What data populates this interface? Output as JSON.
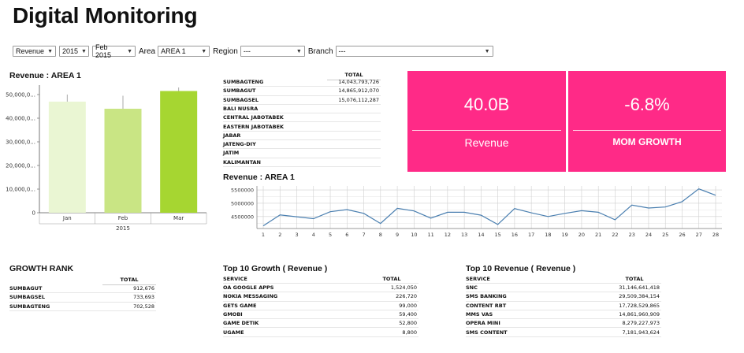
{
  "page": {
    "title": "Digital Monitoring"
  },
  "filters": {
    "metric": "Revenue",
    "year": "2015",
    "period": "Feb 2015",
    "area_label": "Area",
    "area": "AREA 1",
    "region_label": "Region",
    "region": "---",
    "branch_label": "Branch",
    "branch": "---"
  },
  "bar_panel": {
    "title": "Revenue : AREA 1",
    "chart_data": {
      "type": "bar",
      "categories": [
        "Jan",
        "Feb",
        "Mar"
      ],
      "values": [
        47000000,
        44000000,
        51500000
      ],
      "error_high": [
        50000000,
        49500000,
        53000000
      ],
      "xlabel": "2015",
      "ylim": [
        0,
        54000000
      ],
      "yticks": [
        0,
        10000000,
        20000000,
        30000000,
        40000000,
        50000000
      ],
      "ytick_labels": [
        "0",
        "10,000,0...",
        "20,000,0...",
        "30,000,0...",
        "40,000,0...",
        "50,000,0..."
      ],
      "colors": [
        "#eaf6d3",
        "#c9e584",
        "#a6d631"
      ]
    }
  },
  "region_table": {
    "header": "TOTAL",
    "rows": [
      {
        "name": "SUMBAGTENG",
        "total": "14,043,793,726"
      },
      {
        "name": "SUMBAGUT",
        "total": "14,865,912,070"
      },
      {
        "name": "SUMBAGSEL",
        "total": "15,076,112,287"
      },
      {
        "name": "BALI NUSRA",
        "total": ""
      },
      {
        "name": "CENTRAL JABOTABEK",
        "total": ""
      },
      {
        "name": "EASTERN JABOTABEK",
        "total": ""
      },
      {
        "name": "JABAR",
        "total": ""
      },
      {
        "name": "JATENG-DIY",
        "total": ""
      },
      {
        "name": "JATIM",
        "total": ""
      },
      {
        "name": "KALIMANTAN",
        "total": ""
      }
    ]
  },
  "kpis": {
    "revenue": {
      "value": "40.0B",
      "label": "Revenue"
    },
    "growth": {
      "value": "-6.8%",
      "label": "MOM GROWTH"
    }
  },
  "line_panel": {
    "title": "Revenue : AREA 1",
    "chart_data": {
      "type": "line",
      "x": [
        1,
        2,
        3,
        4,
        5,
        6,
        7,
        8,
        9,
        10,
        11,
        12,
        13,
        14,
        15,
        16,
        17,
        18,
        19,
        20,
        21,
        22,
        23,
        24,
        25,
        26,
        27,
        28
      ],
      "values": [
        4150000,
        4560000,
        4490000,
        4420000,
        4680000,
        4760000,
        4620000,
        4240000,
        4810000,
        4710000,
        4440000,
        4660000,
        4660000,
        4550000,
        4200000,
        4800000,
        4640000,
        4500000,
        4620000,
        4720000,
        4660000,
        4380000,
        4930000,
        4820000,
        4860000,
        5060000,
        5540000,
        5300000
      ],
      "ylim": [
        4050000,
        5650000
      ],
      "yticks": [
        4500000,
        5000000,
        5500000
      ],
      "ytick_labels": [
        "4500000",
        "5000000",
        "5500000"
      ],
      "color": "#4a7fb0"
    }
  },
  "growth_rank": {
    "title": "GROWTH RANK",
    "header": "TOTAL",
    "rows": [
      {
        "name": "SUMBAGUT",
        "total": "912,676"
      },
      {
        "name": "SUMBAGSEL",
        "total": "733,693"
      },
      {
        "name": "SUMBAGTENG",
        "total": "702,528"
      }
    ]
  },
  "top_growth": {
    "title": "Top 10 Growth ( Revenue )",
    "col_service": "SERVICE",
    "col_total": "TOTAL",
    "rows": [
      {
        "name": "OA GOOGLE APPS",
        "total": "1,524,050"
      },
      {
        "name": "NOKIA MESSAGING",
        "total": "226,720"
      },
      {
        "name": "GETS GAME",
        "total": "99,000"
      },
      {
        "name": "GMOBI",
        "total": "59,400"
      },
      {
        "name": "GAME DETIK",
        "total": "52,800"
      },
      {
        "name": "UGAME",
        "total": "8,800"
      }
    ]
  },
  "top_revenue": {
    "title": "Top 10 Revenue ( Revenue )",
    "col_service": "SERVICE",
    "col_total": "TOTAL",
    "rows": [
      {
        "name": "SNC",
        "total": "31,146,641,418"
      },
      {
        "name": "SMS BANKING",
        "total": "29,509,384,154"
      },
      {
        "name": "CONTENT RBT",
        "total": "17,728,529,865"
      },
      {
        "name": "MMS VAS",
        "total": "14,861,960,909"
      },
      {
        "name": "OPERA MINI",
        "total": "8,279,227,973"
      },
      {
        "name": "SMS CONTENT",
        "total": "7,181,943,624"
      }
    ]
  }
}
